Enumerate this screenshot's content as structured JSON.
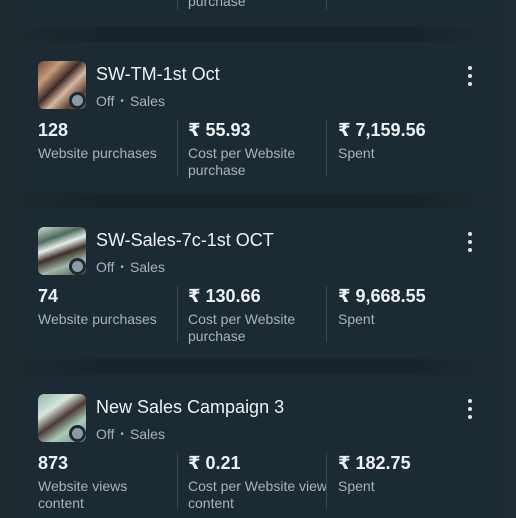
{
  "top_card": {
    "partial_label": "purchase"
  },
  "campaigns": [
    {
      "name": "SW-TM-1st Oct",
      "status": "Off",
      "objective": "Sales",
      "metrics": [
        {
          "value": "128",
          "label": "Website purchases"
        },
        {
          "value": "₹ 55.93",
          "label": "Cost per Website purchase"
        },
        {
          "value": "₹ 7,159.56",
          "label": "Spent"
        }
      ]
    },
    {
      "name": "SW-Sales-7c-1st OCT",
      "status": "Off",
      "objective": "Sales",
      "metrics": [
        {
          "value": "74",
          "label": "Website purchases"
        },
        {
          "value": "₹ 130.66",
          "label": "Cost per Website purchase"
        },
        {
          "value": "₹ 9,668.55",
          "label": "Spent"
        }
      ]
    },
    {
      "name": "New Sales Campaign 3",
      "status": "Off",
      "objective": "Sales",
      "metrics": [
        {
          "value": "873",
          "label": "Website views content"
        },
        {
          "value": "₹ 0.21",
          "label": "Cost per Website view content"
        },
        {
          "value": "₹ 182.75",
          "label": "Spent"
        }
      ]
    }
  ],
  "icons": {
    "more": "more-vertical-icon",
    "status_dot": "status-off-dot"
  },
  "colors": {
    "card_bg": "#1b2a33",
    "page_bg": "#18242a",
    "muted_text": "#a8b3ba",
    "status_off": "#8e9aa3"
  }
}
